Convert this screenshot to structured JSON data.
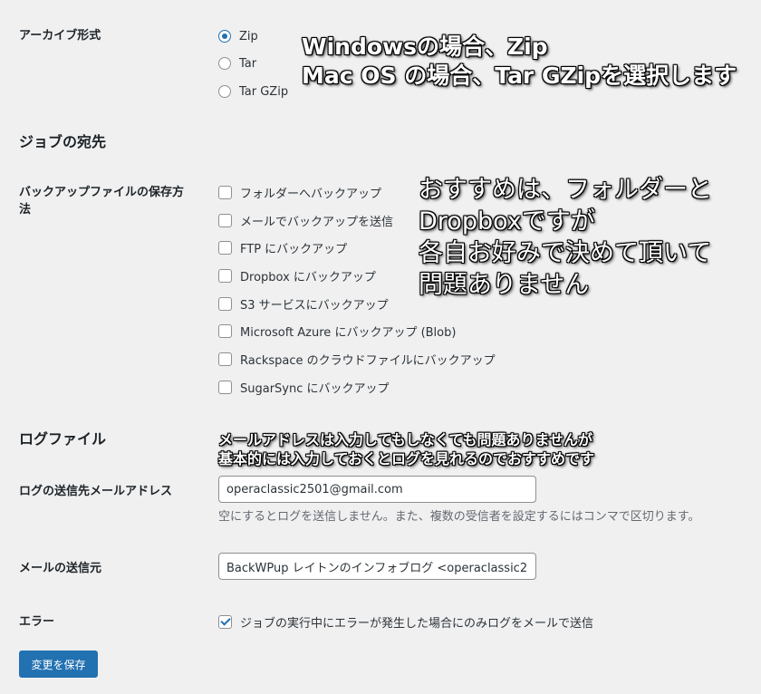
{
  "archive": {
    "label": "アーカイブ形式",
    "options": [
      "Zip",
      "Tar",
      "Tar GZip"
    ],
    "selected": "Zip"
  },
  "job_destination": {
    "title": "ジョブの宛先",
    "label_line1": "バックアップファイルの保存方",
    "label_line2": "法",
    "options": [
      "フォルダーへバックアップ",
      "メールでバックアップを送信",
      "FTP にバックアップ",
      "Dropbox にバックアップ",
      "S3 サービスにバックアップ",
      "Microsoft Azure にバックアップ (Blob)",
      "Rackspace のクラウドファイルにバックアップ",
      "SugarSync にバックアップ"
    ]
  },
  "log": {
    "title": "ログファイル",
    "email_label": "ログの送信先メールアドレス",
    "email_value": "operaclassic2501@gmail.com",
    "email_desc": "空にするとログを送信しません。また、複数の受信者を設定するにはコンマで区切ります。",
    "sender_label": "メールの送信元",
    "sender_value": "BackWPup レイトンのインフォブログ <operaclassic2",
    "error_label": "エラー",
    "error_option": "ジョブの実行中にエラーが発生した場合にのみログをメールで送信",
    "error_checked": true
  },
  "save_button": "変更を保存",
  "annotations": {
    "archive_note": [
      "Windowsの場合、Zip",
      "Mac OS の場合、Tar GZipを選択します"
    ],
    "destination_note": [
      "おすすめは、フォルダーと",
      "Dropboxですが",
      "各自お好みで決めて頂いて",
      "問題ありません"
    ],
    "email_note": [
      "メールアドレスは入力してもしなくても問題ありませんが",
      "基本的には入力しておくとログを見れるのでおすすめです"
    ]
  },
  "colors": {
    "background": "#f0f0f1",
    "accent": "#2271b1",
    "text": "#1d2327",
    "description": "#646970"
  }
}
